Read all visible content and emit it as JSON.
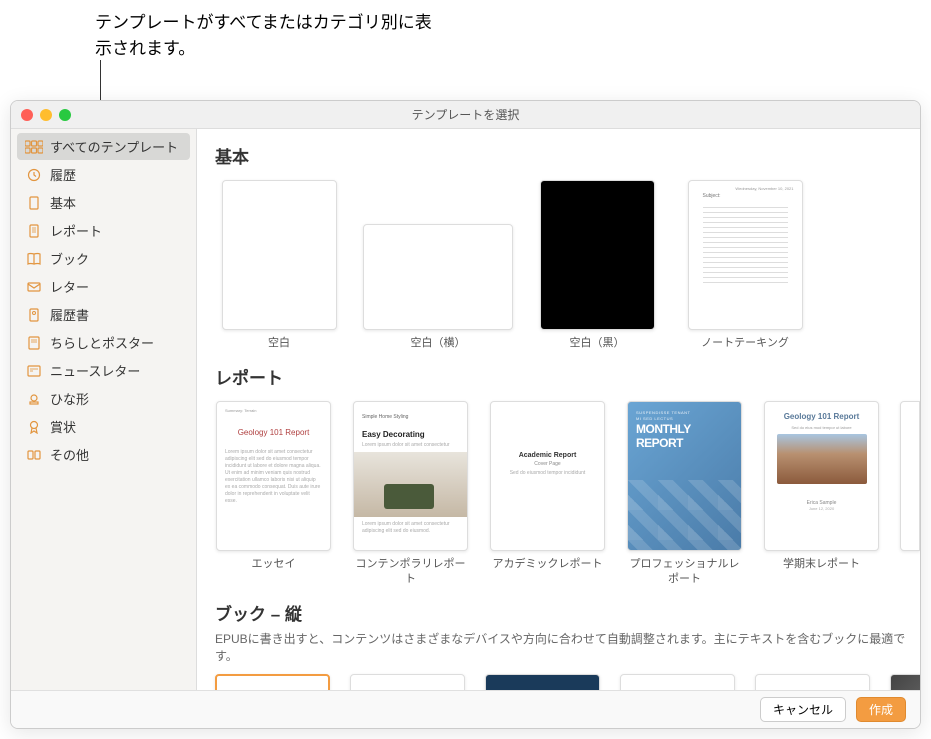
{
  "callout": "テンプレートがすべてまたはカテゴリ別に表示されます。",
  "window_title": "テンプレートを選択",
  "sidebar": {
    "items": [
      {
        "label": "すべてのテンプレート",
        "selected": true,
        "icon": "grid"
      },
      {
        "label": "履歴",
        "selected": false,
        "icon": "clock"
      },
      {
        "label": "基本",
        "selected": false,
        "icon": "doc"
      },
      {
        "label": "レポート",
        "selected": false,
        "icon": "doclines"
      },
      {
        "label": "ブック",
        "selected": false,
        "icon": "book"
      },
      {
        "label": "レター",
        "selected": false,
        "icon": "envelope"
      },
      {
        "label": "履歴書",
        "selected": false,
        "icon": "person"
      },
      {
        "label": "ちらしとポスター",
        "selected": false,
        "icon": "poster"
      },
      {
        "label": "ニュースレター",
        "selected": false,
        "icon": "news"
      },
      {
        "label": "ひな形",
        "selected": false,
        "icon": "stamp"
      },
      {
        "label": "賞状",
        "selected": false,
        "icon": "ribbon"
      },
      {
        "label": "その他",
        "selected": false,
        "icon": "misc"
      }
    ]
  },
  "sections": {
    "basic": {
      "title": "基本",
      "templates": [
        {
          "label": "空白"
        },
        {
          "label": "空白（横）"
        },
        {
          "label": "空白（黒）"
        },
        {
          "label": "ノートテーキング"
        }
      ]
    },
    "report": {
      "title": "レポート",
      "templates": [
        {
          "label": "エッセイ",
          "thumb_title": "Geology 101 Report"
        },
        {
          "label": "コンテンポラリレポート",
          "thumb_title": "Easy Decorating",
          "thumb_sub": "Simple Home Styling"
        },
        {
          "label": "アカデミックレポート",
          "thumb_title": "Academic Report",
          "thumb_sub": "Cover Page"
        },
        {
          "label": "プロフェッショナルレポート",
          "thumb_title": "MONTHLY",
          "thumb_sub2": "REPORT"
        },
        {
          "label": "学期末レポート",
          "thumb_title": "Geology 101 Report"
        }
      ]
    },
    "book": {
      "title": "ブック – 縦",
      "desc": "EPUBに書き出すと、コンテンツはさまざまなデバイスや方向に合わせて自動調整されます。主にテキストを含むブックに最適です。"
    }
  },
  "footer": {
    "cancel": "キャンセル",
    "create": "作成"
  }
}
